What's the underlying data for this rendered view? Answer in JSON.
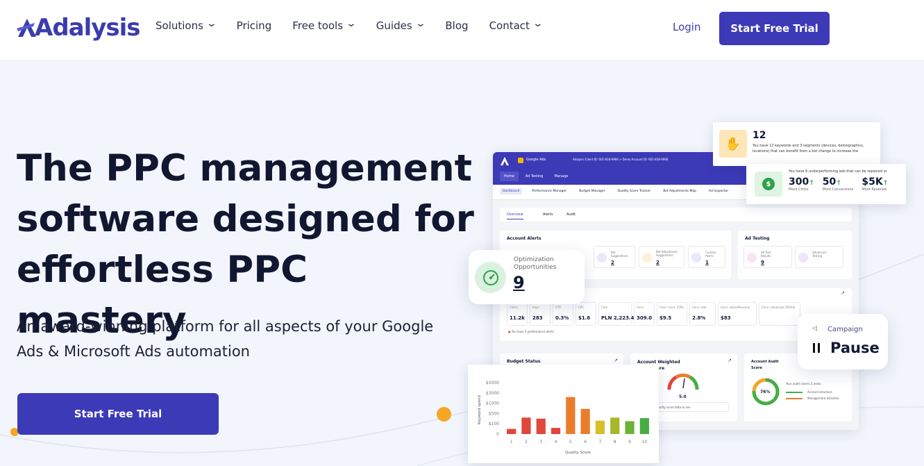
{
  "header": {
    "logo": "Adalysis",
    "nav": [
      {
        "label": "Solutions",
        "dropdown": true
      },
      {
        "label": "Pricing",
        "dropdown": false
      },
      {
        "label": "Free tools",
        "dropdown": true
      },
      {
        "label": "Guides",
        "dropdown": true
      },
      {
        "label": "Blog",
        "dropdown": false
      },
      {
        "label": "Contact",
        "dropdown": true
      }
    ],
    "login": "Login",
    "cta": "Start Free Trial"
  },
  "hero": {
    "title_lines": [
      "The PPC management",
      "software designed for",
      "effortless PPC mastery"
    ],
    "subtitle_lines": [
      "An award-winning platform for all aspects of your Google",
      "Ads & Microsoft Ads automation"
    ],
    "cta": "Start Free Trial"
  },
  "dashboard": {
    "brand": "Google Ads",
    "client": "Adalysis Client ID: 601-818-6966 > Demo Account ID: 601-818-6966",
    "top_tabs": [
      "Home",
      "Ad Testing",
      "Manage"
    ],
    "sub_tabs": [
      "Dashboard",
      "Performance Manager",
      "Budget Manager",
      "Quality Score Tracker",
      "Bid Adjustments Map",
      "Ad Inspector"
    ],
    "view_tabs": [
      "Overview",
      "Alerts",
      "Audit"
    ],
    "account_alerts": {
      "title": "Account Alerts",
      "items": [
        {
          "label": "Bid Suggestions",
          "value": "2"
        },
        {
          "label": "Bid Adjustment Suggestions",
          "value": "2"
        },
        {
          "label": "Custom Alerts",
          "value": "1"
        }
      ]
    },
    "ad_testing": {
      "title": "Ad Testing",
      "items": [
        {
          "label": "Ad Test Results",
          "value": "9"
        },
        {
          "label": "Advanced Testing",
          "value": ""
        }
      ]
    },
    "metrics": [
      {
        "label": "Clicks",
        "value": "11.2k"
      },
      {
        "label": "Impr.",
        "value": "283"
      },
      {
        "label": "CTR",
        "value": "0.3%"
      },
      {
        "label": "CPC",
        "value": "$1.6"
      },
      {
        "label": "Cost",
        "value": "PLN 2,223.4k"
      },
      {
        "label": "Conv.",
        "value": "309.0"
      },
      {
        "label": "Cost / conv. (CPA)",
        "value": "$9.5"
      },
      {
        "label": "Conv. rate",
        "value": "2.8%"
      },
      {
        "label": "Conv. value/Revenue",
        "value": "$83"
      },
      {
        "label": "Conv. value/cost (ROAS)",
        "value": ""
      }
    ],
    "perf_note": "You have 3 performance alerts",
    "budget_status": "Budget Status",
    "account_weighted": "Account Weighted",
    "weighted_suffix": "ore",
    "weighted_value": "5.0",
    "weighted_note": "quality score data to see",
    "audit": {
      "title": "Account Audit Score",
      "value": "76%",
      "note": "Your audit covers 2 areas",
      "items": [
        "Account structure",
        "Management activities"
      ]
    }
  },
  "bid_card": {
    "value": "12",
    "text": "You have 12 keywords and 3 segments (devices, demographics, locations) that can benefit from a bid change to increase the"
  },
  "ads_card": {
    "text": "You have 6 underperforming ads that can be replaced or",
    "stats": [
      {
        "value": "300",
        "label": "More Clicks"
      },
      {
        "value": "50",
        "label": "More Conversions"
      },
      {
        "value": "$5K",
        "label": "More Revenue"
      }
    ]
  },
  "opt_card": {
    "label_lines": [
      "Optimization",
      "Opportunities"
    ],
    "value": "9"
  },
  "campaign_card": {
    "label": "Campaign",
    "value": "Pause"
  },
  "chart_data": {
    "type": "bar",
    "categories": [
      "1",
      "2",
      "3",
      "4",
      "5",
      "6",
      "7",
      "8",
      "9",
      "10"
    ],
    "values": [
      500,
      1600,
      1500,
      600,
      3600,
      2450,
      1300,
      1600,
      1250,
      1550
    ],
    "colors": [
      "#e0463c",
      "#e0463c",
      "#e0463c",
      "#e0463c",
      "#ea7d2c",
      "#ea7d2c",
      "#d8bf28",
      "#a4b828",
      "#6cb23a",
      "#46ad44"
    ],
    "ytick_labels": [
      "0",
      "$100",
      "$500",
      "$1000",
      "$3000",
      "$5000"
    ],
    "yticks": [
      0,
      1000,
      2000,
      3000,
      4000,
      5000
    ],
    "ylim": [
      0,
      5000
    ],
    "xlabel": "Quality Score",
    "ylabel": "Keyword spend"
  }
}
